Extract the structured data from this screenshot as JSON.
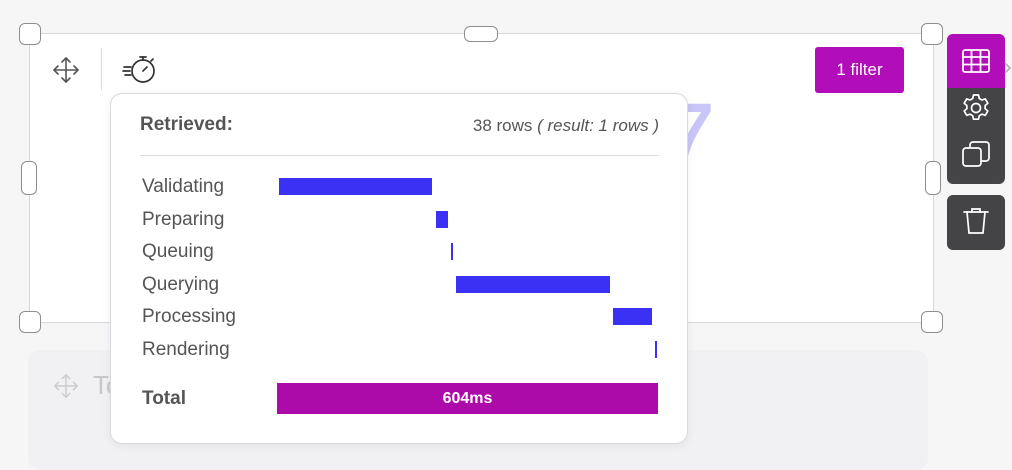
{
  "background_card": {
    "text": "To"
  },
  "widget": {
    "big_number": "7",
    "filter_button": "1 filter"
  },
  "toolbar": {
    "icons": [
      "table-grid-icon",
      "gear-icon",
      "duplicate-icon",
      "trash-icon"
    ]
  },
  "timing_popover": {
    "title": "Retrieved:",
    "rows_text": "38 rows",
    "result_text": "( result: 1 rows )",
    "stages": [
      {
        "label": "Validating",
        "start_fraction": 0.0,
        "end_fraction": 0.405
      },
      {
        "label": "Preparing",
        "start_fraction": 0.415,
        "end_fraction": 0.446
      },
      {
        "label": "Queuing",
        "start_fraction": 0.455,
        "end_fraction": 0.458
      },
      {
        "label": "Querying",
        "start_fraction": 0.467,
        "end_fraction": 0.873
      },
      {
        "label": "Processing",
        "start_fraction": 0.882,
        "end_fraction": 0.984
      },
      {
        "label": "Rendering",
        "start_fraction": 0.993,
        "end_fraction": 0.998
      }
    ],
    "total_label": "Total",
    "total_value": "604ms"
  },
  "colors": {
    "accent": "#b10db8",
    "stage_bar": "#3b31f5",
    "total_bar": "#ad0aaa",
    "toolbar": "#444447"
  }
}
